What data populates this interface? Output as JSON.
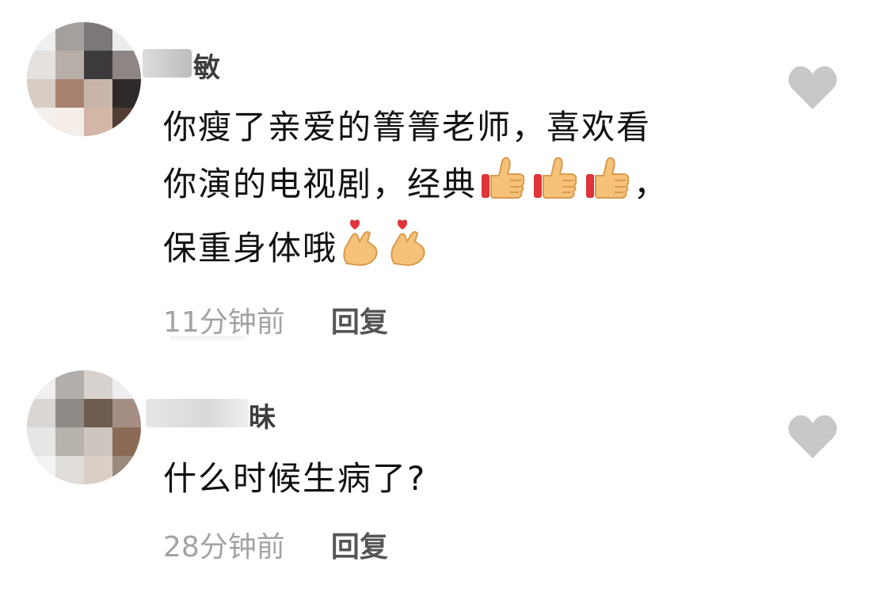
{
  "comments": [
    {
      "username_visible": "敏",
      "text_lines": [
        "你瘦了亲爱的箐箐老师，喜欢看",
        "你演的电视剧，经典",
        "，",
        "保重身体哦"
      ],
      "time": "11分钟前",
      "reply_label": "回复",
      "like_icon": "heart-icon",
      "emojis": [
        "thumbs-up-icon",
        "thumbs-up-icon",
        "thumbs-up-icon",
        "finger-heart-icon",
        "finger-heart-icon"
      ]
    },
    {
      "username_visible": "昧",
      "text_lines": [
        "什么时候生病了?"
      ],
      "time": "28分钟前",
      "reply_label": "回复",
      "like_icon": "heart-icon"
    }
  ],
  "colors": {
    "time": "#a3a3a3",
    "reply": "#555555",
    "heart": "#c8c8c8",
    "thumb": "#f6c27a",
    "thumb_cuff": "#e0333a"
  }
}
